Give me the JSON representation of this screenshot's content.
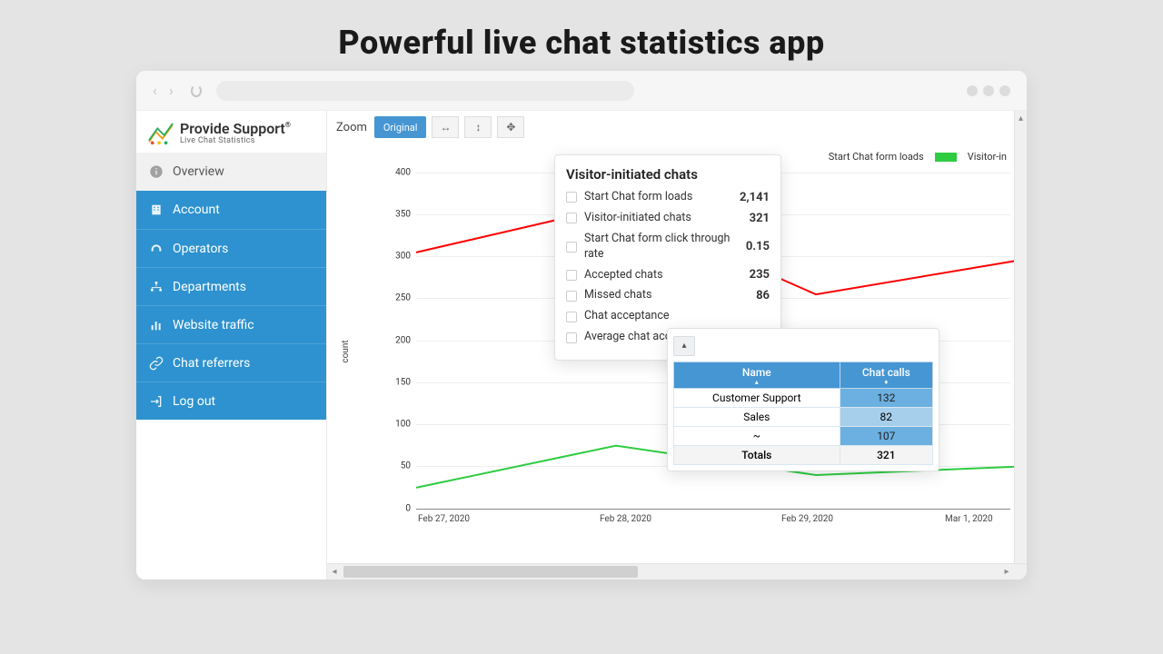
{
  "hero": {
    "title": "Powerful live chat statistics app"
  },
  "brand": {
    "name": "Provide Support",
    "tag": "Live Chat Statistics",
    "reg": "®"
  },
  "sidebar": {
    "items": [
      {
        "label": "Overview"
      },
      {
        "label": "Account"
      },
      {
        "label": "Operators"
      },
      {
        "label": "Departments"
      },
      {
        "label": "Website traffic"
      },
      {
        "label": "Chat referrers"
      },
      {
        "label": "Log out"
      }
    ]
  },
  "zoom": {
    "label": "Zoom",
    "original": "Original"
  },
  "legend": {
    "a": "Start Chat form loads",
    "b": "Visitor-in"
  },
  "colors": {
    "series_a": "#ff0000",
    "series_b": "#2ecc40"
  },
  "axis": {
    "ylabel": "count",
    "yticks": [
      "0",
      "50",
      "100",
      "150",
      "200",
      "250",
      "300",
      "350",
      "400"
    ],
    "xticks": [
      "Feb 27, 2020",
      "Feb 28, 2020",
      "Feb 29, 2020",
      "Mar 1, 2020"
    ]
  },
  "tooltip": {
    "title": "Visitor-initiated chats",
    "rows": [
      {
        "label": "Start Chat form loads",
        "value": "2,141"
      },
      {
        "label": "Visitor-initiated chats",
        "value": "321"
      },
      {
        "label": "Start Chat form click through rate",
        "value": "0.15"
      },
      {
        "label": "Accepted chats",
        "value": "235"
      },
      {
        "label": "Missed chats",
        "value": "86"
      },
      {
        "label": "Chat acceptance",
        "value": ""
      },
      {
        "label": "Average chat acc",
        "value": ""
      }
    ]
  },
  "pop": {
    "headers": {
      "name": "Name",
      "calls": "Chat calls"
    },
    "rows": [
      {
        "name": "Customer Support",
        "calls": "132"
      },
      {
        "name": "Sales",
        "calls": "82"
      },
      {
        "name": "~",
        "calls": "107"
      }
    ],
    "totals": {
      "label": "Totals",
      "value": "321"
    }
  },
  "chart_data": {
    "type": "line",
    "title": "",
    "xlabel": "",
    "ylabel": "count",
    "ylim": [
      0,
      400
    ],
    "categories": [
      "Feb 27, 2020",
      "Feb 28, 2020",
      "Feb 29, 2020",
      "Mar 1, 2020"
    ],
    "series": [
      {
        "name": "Start Chat form loads",
        "color": "#ff0000",
        "values": [
          305,
          360,
          255,
          295
        ]
      },
      {
        "name": "Visitor-initiated chats",
        "color": "#2ecc40",
        "values": [
          25,
          75,
          40,
          50
        ]
      }
    ]
  }
}
